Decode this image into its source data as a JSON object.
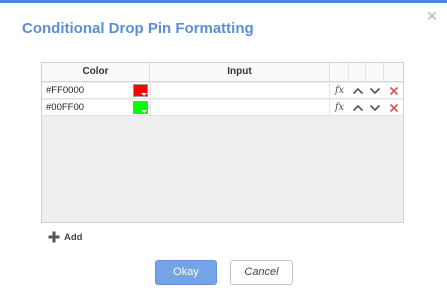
{
  "dialog": {
    "title": "Conditional Drop Pin Formatting",
    "close_icon": "close-icon",
    "accent_color": "#4a86dc"
  },
  "grid": {
    "columns": {
      "color": "Color",
      "input": "Input"
    },
    "rows": [
      {
        "hex": "#FF0000",
        "swatch": "#FF0000",
        "input": ""
      },
      {
        "hex": "#00FF00",
        "swatch": "#00FF00",
        "input": ""
      }
    ],
    "row_icons": [
      "fx-icon",
      "move-up-icon",
      "move-down-icon",
      "delete-icon"
    ],
    "fx_label": "fx"
  },
  "add": {
    "label": "Add",
    "icon": "plus-icon"
  },
  "buttons": {
    "ok": "Okay",
    "cancel": "Cancel"
  }
}
